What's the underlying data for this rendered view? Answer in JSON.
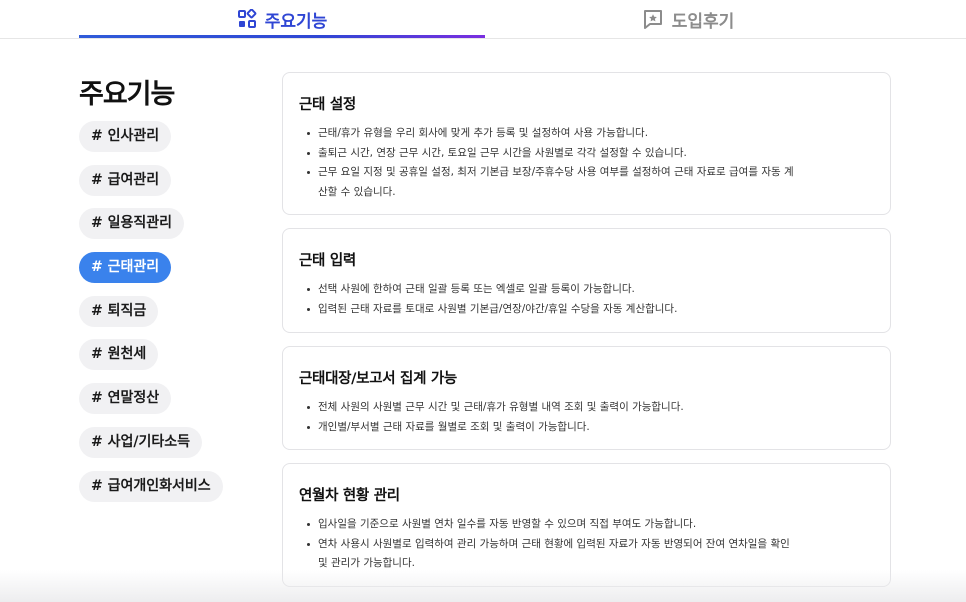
{
  "tabs": [
    {
      "label": "주요기능",
      "icon": "feature-grid-icon",
      "active": true
    },
    {
      "label": "도입후기",
      "icon": "review-star-chat-icon",
      "active": false
    }
  ],
  "colors": {
    "accent": "#2f46d4",
    "chip_active": "#3a82ec",
    "chip_bg": "#f1f1f3"
  },
  "sidebar": {
    "title": "주요기능",
    "chips": [
      {
        "label": "# 인사관리"
      },
      {
        "label": "# 급여관리"
      },
      {
        "label": "# 일용직관리"
      },
      {
        "label": "# 근태관리",
        "active": true
      },
      {
        "label": "# 퇴직금"
      },
      {
        "label": "# 원천세"
      },
      {
        "label": "# 연말정산"
      },
      {
        "label": "# 사업/기타소득"
      },
      {
        "label": "# 급여개인화서비스"
      }
    ]
  },
  "cards": [
    {
      "title": "근태 설정",
      "items": [
        "근태/휴가 유형을 우리 회사에 맞게 추가 등록 및 설정하여 사용 가능합니다.",
        "출퇴근 시간, 연장 근무 시간, 토요일 근무 시간을 사원별로 각각 설정할 수 있습니다.",
        "근무 요일 지정 및 공휴일 설정, 최저 기본급 보장/주휴수당 사용 여부를 설정하여 근태 자료로 급여를 자동 계산할 수 있습니다."
      ]
    },
    {
      "title": "근태 입력",
      "items": [
        "선택 사원에 한하여 근태 일괄 등록 또는 엑셀로 일괄 등록이 가능합니다.",
        "입력된 근태 자료를 토대로 사원별 기본급/연장/야간/휴일 수당을 자동 계산합니다."
      ]
    },
    {
      "title": "근태대장/보고서 집계 가능",
      "items": [
        "전체 사원의 사원별 근무 시간 및 근태/휴가 유형별 내역 조회 및 출력이 가능합니다.",
        "개인별/부서별 근태 자료를 월별로 조회 및 출력이 가능합니다."
      ]
    },
    {
      "title": "연월차 현황 관리",
      "items": [
        "입사일을 기준으로 사원별 연차 일수를 자동 반영할 수 있으며 직접 부여도 가능합니다.",
        "연차 사용시 사원별로 입력하여 관리 가능하며 근태 현황에 입력된 자료가 자동 반영되어 잔여 연차일을 확인 및 관리가 가능합니다."
      ]
    }
  ]
}
